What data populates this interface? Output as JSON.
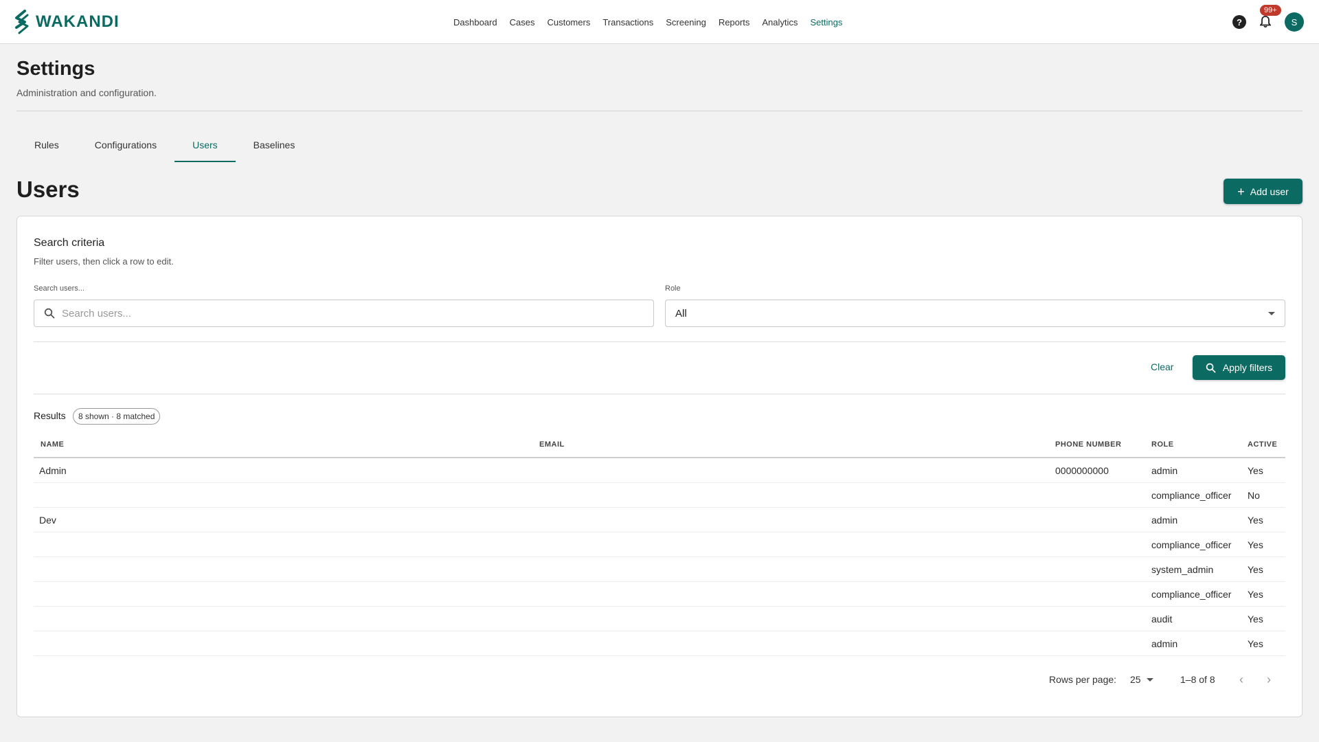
{
  "app": {
    "logo_text": "WAKANDI",
    "brand_color": "#0b6b62"
  },
  "nav": {
    "items": [
      {
        "label": "Dashboard"
      },
      {
        "label": "Cases"
      },
      {
        "label": "Customers"
      },
      {
        "label": "Transactions"
      },
      {
        "label": "Screening"
      },
      {
        "label": "Reports"
      },
      {
        "label": "Analytics"
      },
      {
        "label": "Settings",
        "active": true
      }
    ],
    "notifications_badge": "99+",
    "avatar_initial": "S",
    "icons": [
      "help-icon",
      "bell-icon"
    ]
  },
  "page": {
    "title": "Settings",
    "subtitle": "Administration and configuration."
  },
  "tabs": [
    {
      "label": "Rules"
    },
    {
      "label": "Configurations"
    },
    {
      "label": "Users",
      "active": true
    },
    {
      "label": "Baselines"
    }
  ],
  "users_section": {
    "title": "Users",
    "add_button_label": "Add user"
  },
  "search_criteria": {
    "title": "Search criteria",
    "subtitle": "Filter users, then click a row to edit.",
    "search_label": "Search users...",
    "search_placeholder": "Search users...",
    "search_value": "",
    "role_label": "Role",
    "role_value": "All",
    "clear_label": "Clear",
    "apply_label": "Apply filters"
  },
  "results": {
    "label": "Results",
    "chip": "8 shown · 8 matched",
    "columns": [
      "NAME",
      "EMAIL",
      "PHONE NUMBER",
      "ROLE",
      "ACTIVE"
    ],
    "rows": [
      {
        "name": "Admin",
        "email": "",
        "phone": "0000000000",
        "role": "admin",
        "active": "Yes"
      },
      {
        "name": "",
        "email": "",
        "phone": "",
        "role": "compliance_officer",
        "active": "No"
      },
      {
        "name": "Dev",
        "email": "",
        "phone": "",
        "role": "admin",
        "active": "Yes"
      },
      {
        "name": "",
        "email": "",
        "phone": "",
        "role": "compliance_officer",
        "active": "Yes"
      },
      {
        "name": "",
        "email": "",
        "phone": "",
        "role": "system_admin",
        "active": "Yes"
      },
      {
        "name": "",
        "email": "",
        "phone": "",
        "role": "compliance_officer",
        "active": "Yes"
      },
      {
        "name": "",
        "email": "",
        "phone": "",
        "role": "audit",
        "active": "Yes"
      },
      {
        "name": "",
        "email": "",
        "phone": "",
        "role": "admin",
        "active": "Yes"
      }
    ]
  },
  "pagination": {
    "rows_per_page_label": "Rows per page:",
    "rows_per_page_value": "25",
    "range": "1–8 of 8"
  }
}
